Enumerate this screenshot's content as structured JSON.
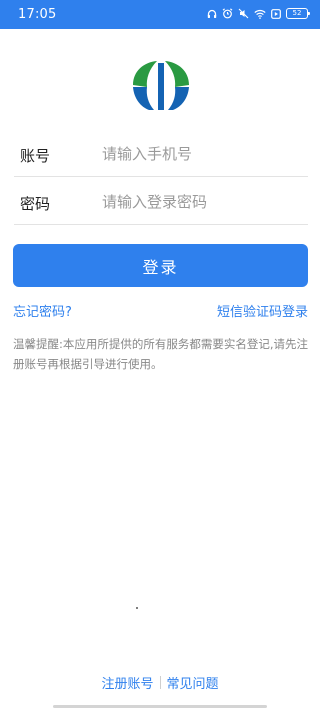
{
  "status_bar": {
    "time": "17:05",
    "battery": "52",
    "icons": [
      "headset-icon",
      "alarm-icon",
      "mute-icon",
      "wifi-icon",
      "media-icon",
      "battery-icon"
    ]
  },
  "logo": {
    "name": "app-logo",
    "colors": {
      "green": "#2a9a42",
      "blue": "#1463b3"
    }
  },
  "form": {
    "account_label": "账号",
    "account_placeholder": "请输入手机号",
    "password_label": "密码",
    "password_placeholder": "请输入登录密码"
  },
  "login_button": "登录",
  "links": {
    "forgot_password": "忘记密码?",
    "sms_login": "短信验证码登录"
  },
  "notice": "温馨提醒:本应用所提供的所有服务都需要实名登记,请先注册账号再根据引导进行使用。",
  "footer": {
    "register": "注册账号",
    "faq": "常见问题"
  },
  "colors": {
    "accent": "#2f80ed",
    "label": "#222222",
    "hint": "#9a9a9a",
    "notice": "#888888"
  }
}
